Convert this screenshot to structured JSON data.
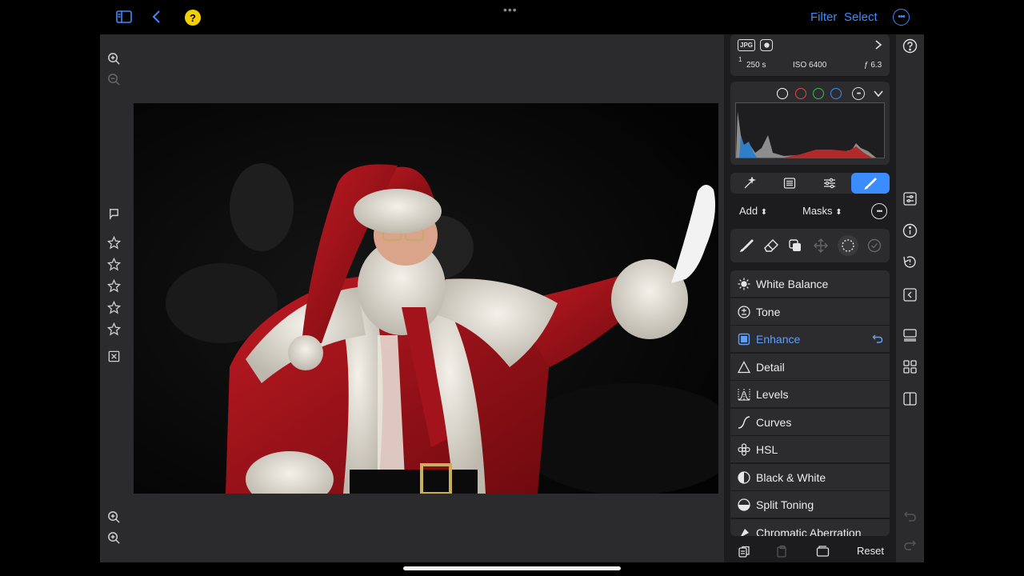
{
  "topbar": {
    "sidebar_icon": "sidebar-icon",
    "back_icon": "chevron-left-icon",
    "help_label": "?",
    "filter_label": "Filter",
    "select_label": "Select",
    "more_icon": "ellipsis-circle-icon",
    "accent_color": "#3b8cff"
  },
  "left_tools": {
    "zoom_in": "zoom-in-icon",
    "zoom_out": "zoom-out-icon",
    "flag": "flag-icon",
    "stars": 5,
    "reject": "reject-icon"
  },
  "exif": {
    "format": "JPG",
    "shutter_num": "1",
    "shutter_den": "250 s",
    "iso": "ISO 6400",
    "aperture": "ƒ 6.3"
  },
  "histogram": {
    "channels": [
      "luminance",
      "red",
      "green",
      "blue"
    ],
    "channel_colors": [
      "#ffffff",
      "#e04848",
      "#3fb950",
      "#3b8cff"
    ]
  },
  "tool_tabs": [
    {
      "name": "auto",
      "icon": "magic-wand-icon"
    },
    {
      "name": "presets",
      "icon": "list-icon"
    },
    {
      "name": "adjustments",
      "icon": "sliders-icon"
    },
    {
      "name": "local",
      "icon": "brush-icon",
      "active": true
    }
  ],
  "mask_bar": {
    "add_label": "Add",
    "masks_label": "Masks"
  },
  "adjustments": [
    {
      "label": "White Balance",
      "icon": "sun-icon"
    },
    {
      "label": "Tone",
      "icon": "plus-minus-icon"
    },
    {
      "label": "Enhance",
      "icon": "square-icon",
      "active": true
    },
    {
      "label": "Detail",
      "icon": "triangle-icon"
    },
    {
      "label": "Levels",
      "icon": "levels-icon"
    },
    {
      "label": "Curves",
      "icon": "curve-icon"
    },
    {
      "label": "HSL",
      "icon": "flower-icon"
    },
    {
      "label": "Black & White",
      "icon": "half-circle-icon"
    },
    {
      "label": "Split Toning",
      "icon": "split-circle-icon"
    },
    {
      "label": "Chromatic Aberration",
      "icon": "prism-icon"
    }
  ],
  "bottom": {
    "reset_label": "Reset"
  }
}
